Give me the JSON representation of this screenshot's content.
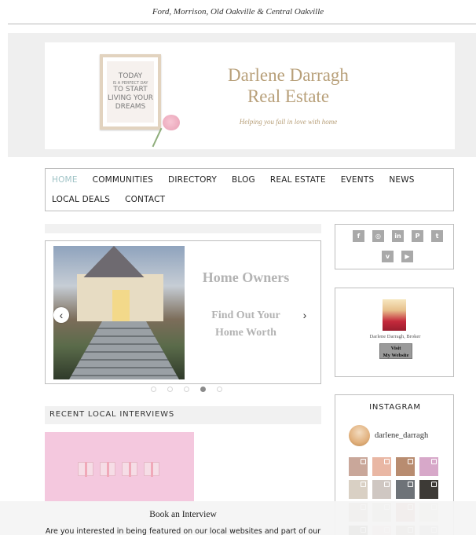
{
  "header": {
    "location_line": "Ford, Morrison, Old Oakville & Central Oakville"
  },
  "banner": {
    "frame_lines": [
      "TODAY",
      "IS A PERFECT DAY",
      "TO START",
      "LIVING YOUR",
      "DREAMS"
    ],
    "brand_name": "Darlene  Darragh",
    "brand_sub": "Real Estate",
    "tagline": "Helping you fall in love with home"
  },
  "nav": {
    "items": [
      {
        "label": "HOME",
        "active": true
      },
      {
        "label": "COMMUNITIES"
      },
      {
        "label": "DIRECTORY"
      },
      {
        "label": "BLOG"
      },
      {
        "label": "REAL ESTATE"
      },
      {
        "label": "EVENTS"
      },
      {
        "label": "NEWS"
      },
      {
        "label": "LOCAL DEALS"
      },
      {
        "label": "CONTACT"
      }
    ]
  },
  "slider": {
    "title": "Home Owners",
    "sub_line1": "Find Out Your",
    "sub_line2": "Home Worth",
    "prev": "‹",
    "next": "›",
    "slide_count": 5,
    "active_slide": 4
  },
  "interviews": {
    "heading": "RECENT LOCAL INTERVIEWS"
  },
  "social": {
    "icons": [
      {
        "name": "facebook-icon",
        "glyph": "f"
      },
      {
        "name": "instagram-icon",
        "glyph": "◎"
      },
      {
        "name": "linkedin-icon",
        "glyph": "in"
      },
      {
        "name": "pinterest-icon",
        "glyph": "P"
      },
      {
        "name": "twitter-icon",
        "glyph": "t"
      },
      {
        "name": "vimeo-icon",
        "glyph": "v"
      },
      {
        "name": "youtube-icon",
        "glyph": "▶"
      }
    ]
  },
  "profile": {
    "caption": "Darlene Darragh, Broker",
    "button_line1": "Visit",
    "button_line2": "My Website"
  },
  "instagram": {
    "heading": "INSTAGRAM",
    "username": "darlene_darragh",
    "thumb_colors": [
      "#c9a79a",
      "#e9b7a4",
      "#b88c70",
      "#d7a8c9",
      "#d9d0c4",
      "#cfc7c2",
      "#6e7378",
      "#3d3a36",
      "#a99a88",
      "#bfb8b0",
      "#c47f63",
      "#d3cbc3",
      "#4a5a3e",
      "#e3c7b7",
      "#9e8a78",
      "#b6b1ab"
    ]
  },
  "footer": {
    "title": "Book an Interview",
    "text": "Are you interested in being featured on our local websites and part of our"
  }
}
